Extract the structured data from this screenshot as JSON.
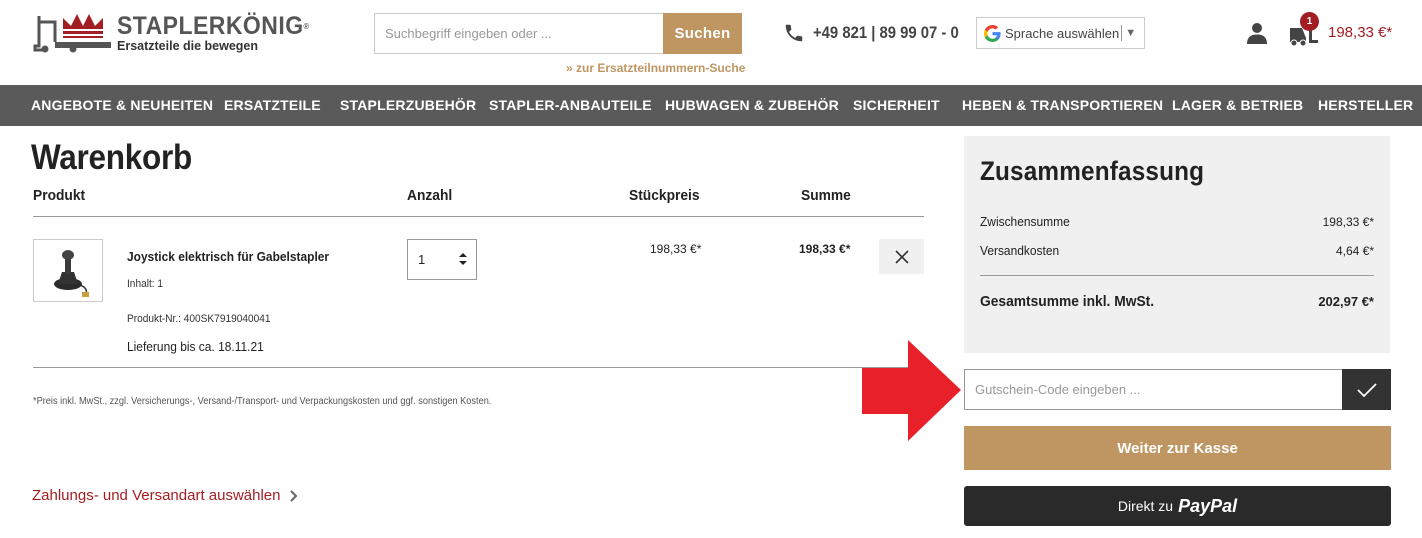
{
  "brand": {
    "name": "STAPLERKÖNIG",
    "trademark": "®",
    "claim": "Ersatzteile die bewegen",
    "colors": {
      "primary_red": "#a31e22",
      "accent_gold": "#bf9662",
      "nav_gray": "#5a5a5a"
    }
  },
  "search": {
    "placeholder": "Suchbegriff eingeben oder ...",
    "button_label": "Suchen",
    "part_number_link": "» zur Ersatzteilnummern-Suche"
  },
  "contact": {
    "phone": "+49 821 | 89 99 07 - 0"
  },
  "language": {
    "label": "Sprache auswählen"
  },
  "cart": {
    "badge_count": "1",
    "total": "198,33 €*"
  },
  "nav": {
    "items": [
      "ANGEBOTE & NEUHEITEN",
      "ERSATZTEILE",
      "STAPLERZUBEHÖR",
      "STAPLER-ANBAUTEILE",
      "HUBWAGEN & ZUBEHÖR",
      "SICHERHEIT",
      "HEBEN & TRANSPORTIEREN",
      "LAGER & BETRIEB",
      "HERSTELLER"
    ]
  },
  "basket": {
    "title": "Warenkorb",
    "columns": {
      "product": "Produkt",
      "quantity": "Anzahl",
      "unit_price": "Stückpreis",
      "sum": "Summe"
    },
    "items": [
      {
        "name": "Joystick elektrisch für Gabelstapler",
        "content": "Inhalt: 1",
        "sku": "Produkt-Nr.: 400SK7919040041",
        "delivery": "Lieferung bis ca. 18.11.21",
        "quantity": "1",
        "unit_price": "198,33 €*",
        "sum": "198,33 €*"
      }
    ],
    "footnote": "*Preis inkl. MwSt., zzgl. Versicherungs-, Versand-/Transport- und Verpackungskosten und ggf. sonstigen Kosten.",
    "payment_link": "Zahlungs- und Versandart auswählen"
  },
  "summary": {
    "title": "Zusammenfassung",
    "subtotal_label": "Zwischensumme",
    "subtotal_value": "198,33 €*",
    "shipping_label": "Versandkosten",
    "shipping_value": "4,64 €*",
    "total_label": "Gesamtsumme inkl. MwSt.",
    "total_value": "202,97 €*"
  },
  "voucher": {
    "placeholder": "Gutschein-Code eingeben ..."
  },
  "checkout": {
    "button_label": "Weiter zur Kasse",
    "paypal_prefix": "Direkt zu",
    "paypal_word": "PayPal"
  },
  "annotation": {
    "arrow_color": "#e8202a"
  }
}
